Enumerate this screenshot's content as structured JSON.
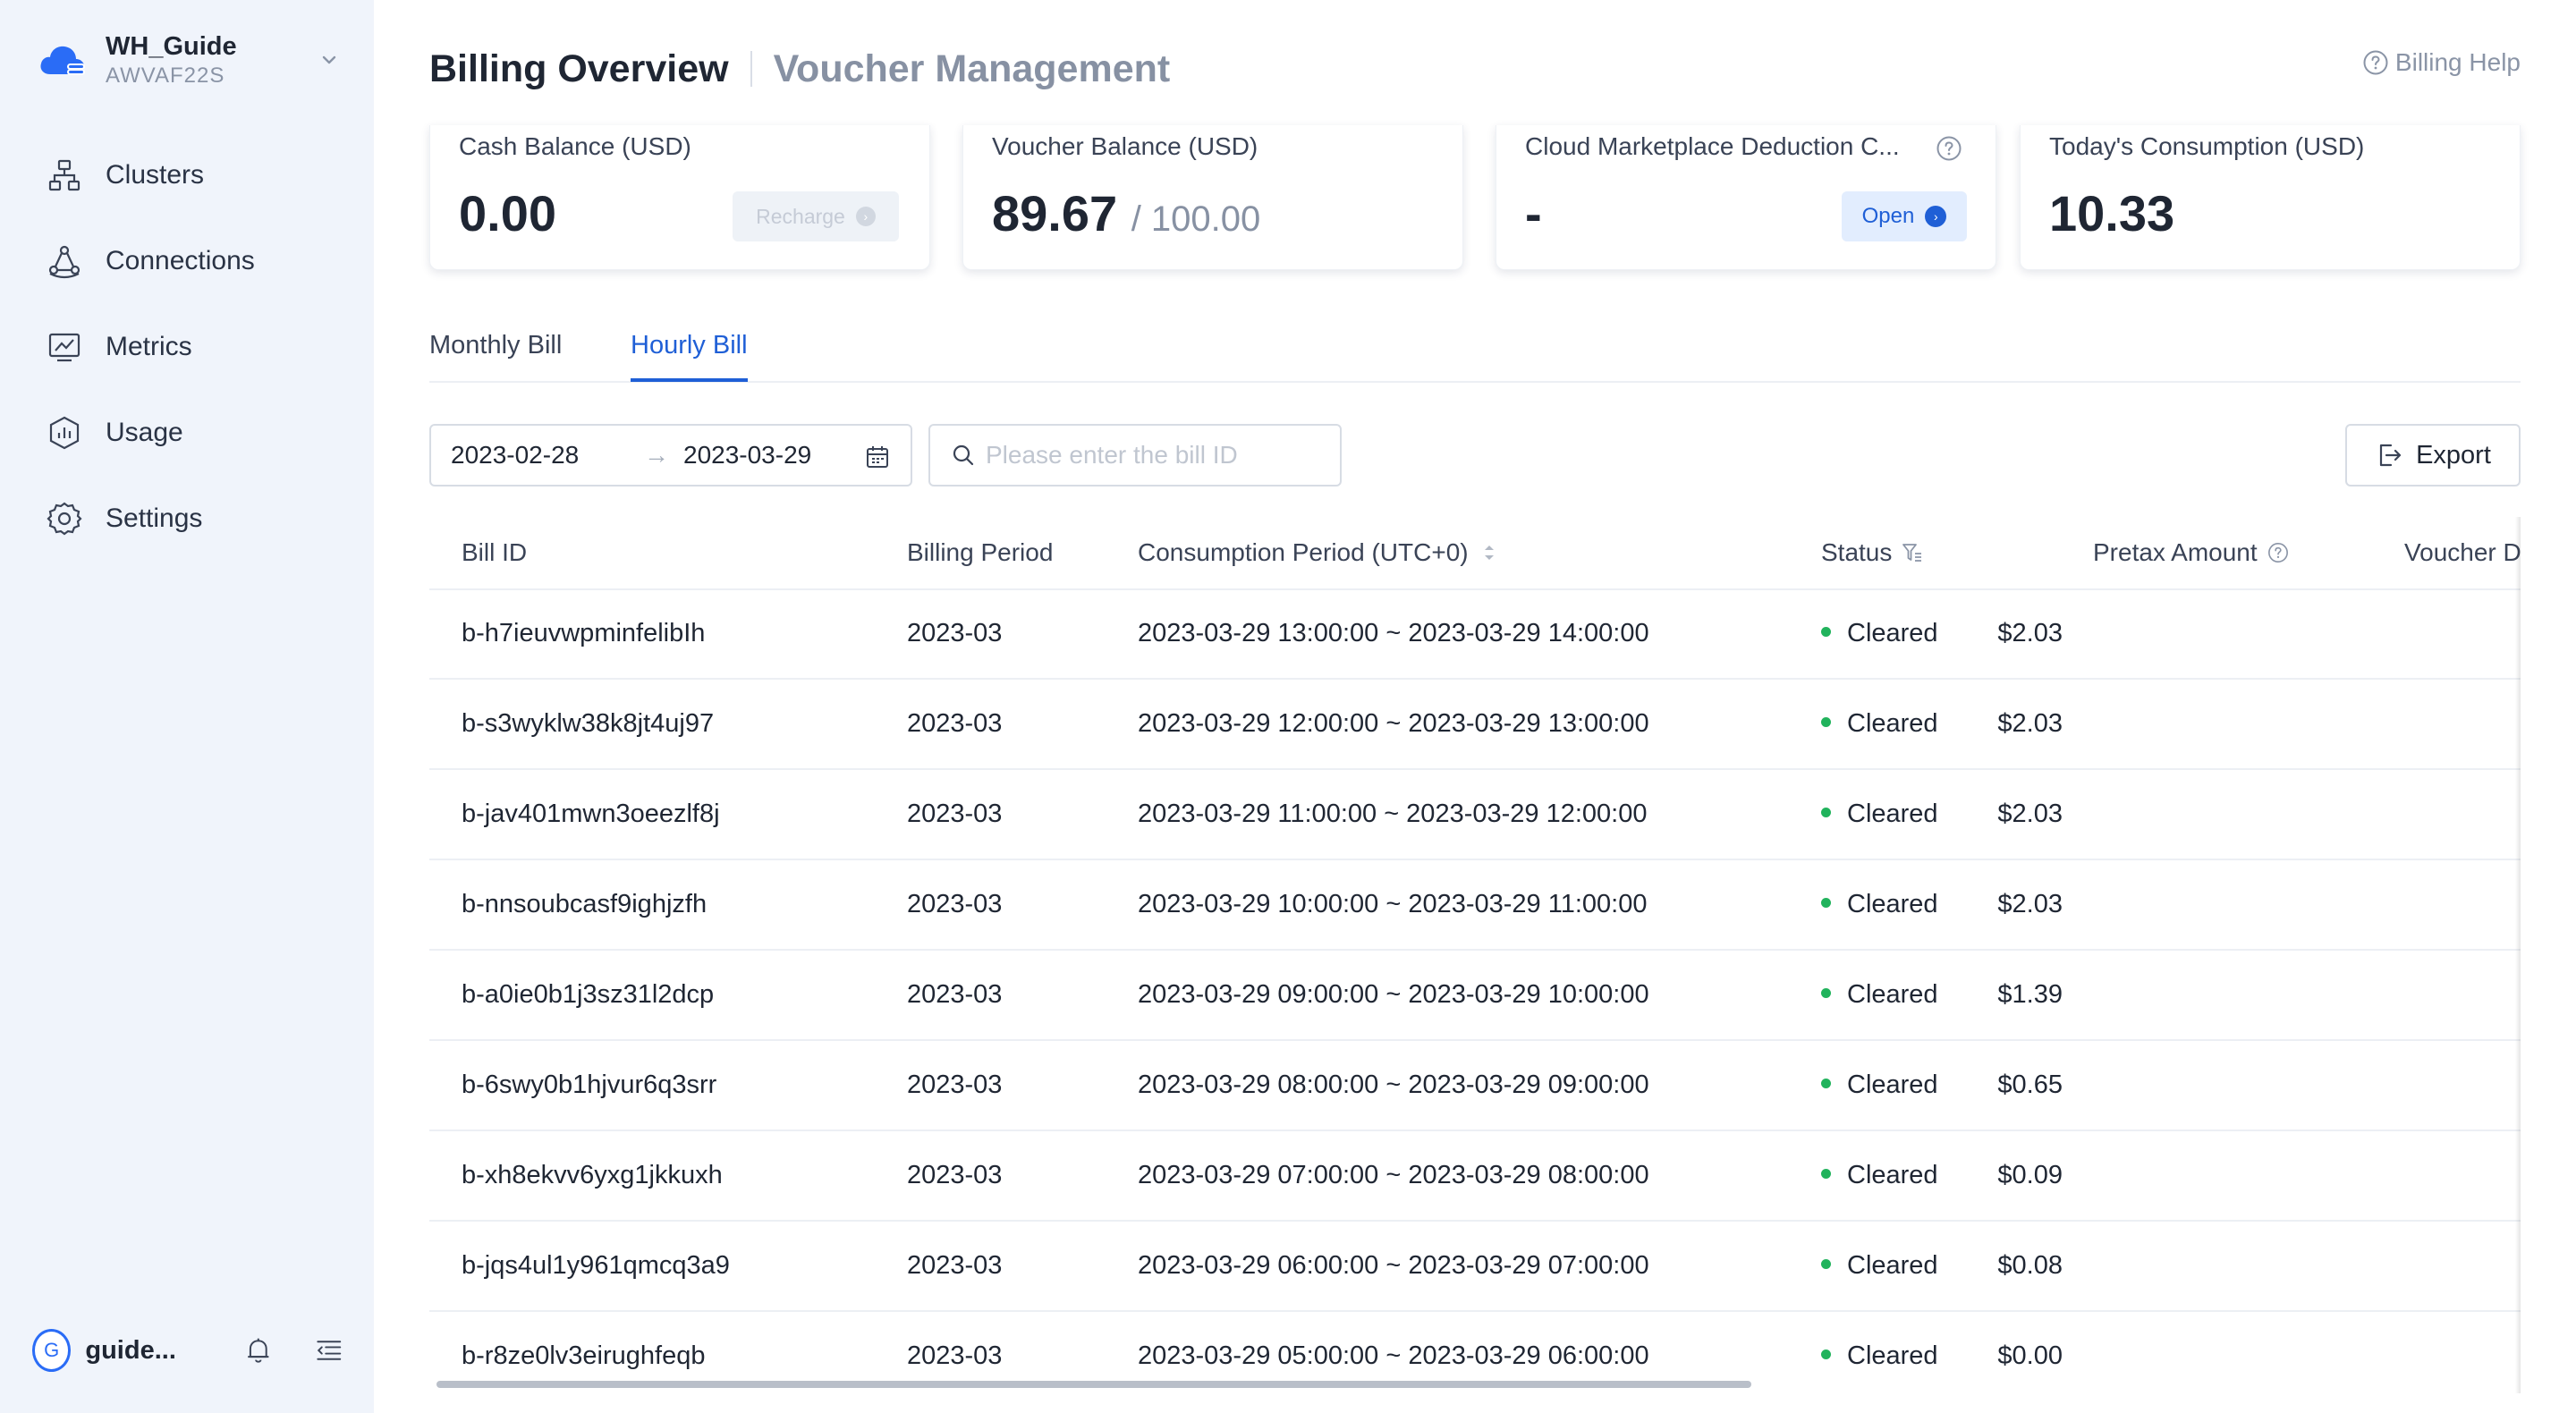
{
  "sidebar": {
    "org_name": "WH_Guide",
    "org_id": "AWVAF22S",
    "items": [
      {
        "label": "Clusters",
        "icon": "clusters-icon"
      },
      {
        "label": "Connections",
        "icon": "connections-icon"
      },
      {
        "label": "Metrics",
        "icon": "metrics-icon"
      },
      {
        "label": "Usage",
        "icon": "usage-icon"
      },
      {
        "label": "Settings",
        "icon": "gear-icon"
      }
    ],
    "user_initial": "G",
    "user_name": "guide..."
  },
  "header": {
    "title": "Billing Overview",
    "title_secondary": "Voucher Management",
    "help_label": "Billing Help"
  },
  "cards": {
    "cash": {
      "label": "Cash Balance (USD)",
      "value": "0.00",
      "button": "Recharge"
    },
    "voucher": {
      "label": "Voucher Balance (USD)",
      "value": "89.67",
      "sub": "/ 100.00"
    },
    "marketplace": {
      "label": "Cloud Marketplace Deduction C...",
      "value": "-",
      "button": "Open"
    },
    "today": {
      "label": "Today's Consumption (USD)",
      "value": "10.33"
    }
  },
  "tabs": [
    {
      "label": "Monthly Bill",
      "active": false
    },
    {
      "label": "Hourly Bill",
      "active": true
    }
  ],
  "toolbar": {
    "date_start": "2023-02-28",
    "date_arrow": "→",
    "date_end": "2023-03-29",
    "search_placeholder": "Please enter the bill ID",
    "export_label": "Export"
  },
  "table": {
    "columns": {
      "bill_id": "Bill ID",
      "billing_period": "Billing Period",
      "consumption_period": "Consumption Period (UTC+0)",
      "status": "Status",
      "pretax_amount": "Pretax Amount",
      "voucher": "Voucher De"
    },
    "rows": [
      {
        "bill_id": "b-h7ieuvwpminfelibIh",
        "billing_period": "2023-03",
        "consumption_period": "2023-03-29 13:00:00 ~ 2023-03-29 14:00:00",
        "status": "Cleared",
        "amount": "$2.03"
      },
      {
        "bill_id": "b-s3wyklw38k8jt4uj97",
        "billing_period": "2023-03",
        "consumption_period": "2023-03-29 12:00:00 ~ 2023-03-29 13:00:00",
        "status": "Cleared",
        "amount": "$2.03"
      },
      {
        "bill_id": "b-jav401mwn3oeezlf8j",
        "billing_period": "2023-03",
        "consumption_period": "2023-03-29 11:00:00 ~ 2023-03-29 12:00:00",
        "status": "Cleared",
        "amount": "$2.03"
      },
      {
        "bill_id": "b-nnsoubcasf9ighjzfh",
        "billing_period": "2023-03",
        "consumption_period": "2023-03-29 10:00:00 ~ 2023-03-29 11:00:00",
        "status": "Cleared",
        "amount": "$2.03"
      },
      {
        "bill_id": "b-a0ie0b1j3sz31l2dcp",
        "billing_period": "2023-03",
        "consumption_period": "2023-03-29 09:00:00 ~ 2023-03-29 10:00:00",
        "status": "Cleared",
        "amount": "$1.39"
      },
      {
        "bill_id": "b-6swy0b1hjvur6q3srr",
        "billing_period": "2023-03",
        "consumption_period": "2023-03-29 08:00:00 ~ 2023-03-29 09:00:00",
        "status": "Cleared",
        "amount": "$0.65"
      },
      {
        "bill_id": "b-xh8ekvv6yxg1jkkuxh",
        "billing_period": "2023-03",
        "consumption_period": "2023-03-29 07:00:00 ~ 2023-03-29 08:00:00",
        "status": "Cleared",
        "amount": "$0.09"
      },
      {
        "bill_id": "b-jqs4ul1y961qmcq3a9",
        "billing_period": "2023-03",
        "consumption_period": "2023-03-29 06:00:00 ~ 2023-03-29 07:00:00",
        "status": "Cleared",
        "amount": "$0.08"
      },
      {
        "bill_id": "b-r8ze0lv3eirughfeqb",
        "billing_period": "2023-03",
        "consumption_period": "2023-03-29 05:00:00 ~ 2023-03-29 06:00:00",
        "status": "Cleared",
        "amount": "$0.00"
      }
    ]
  },
  "colors": {
    "accent": "#1f5fd6",
    "sidebar_bg": "#f0f4fb",
    "status_cleared": "#21b35c"
  }
}
